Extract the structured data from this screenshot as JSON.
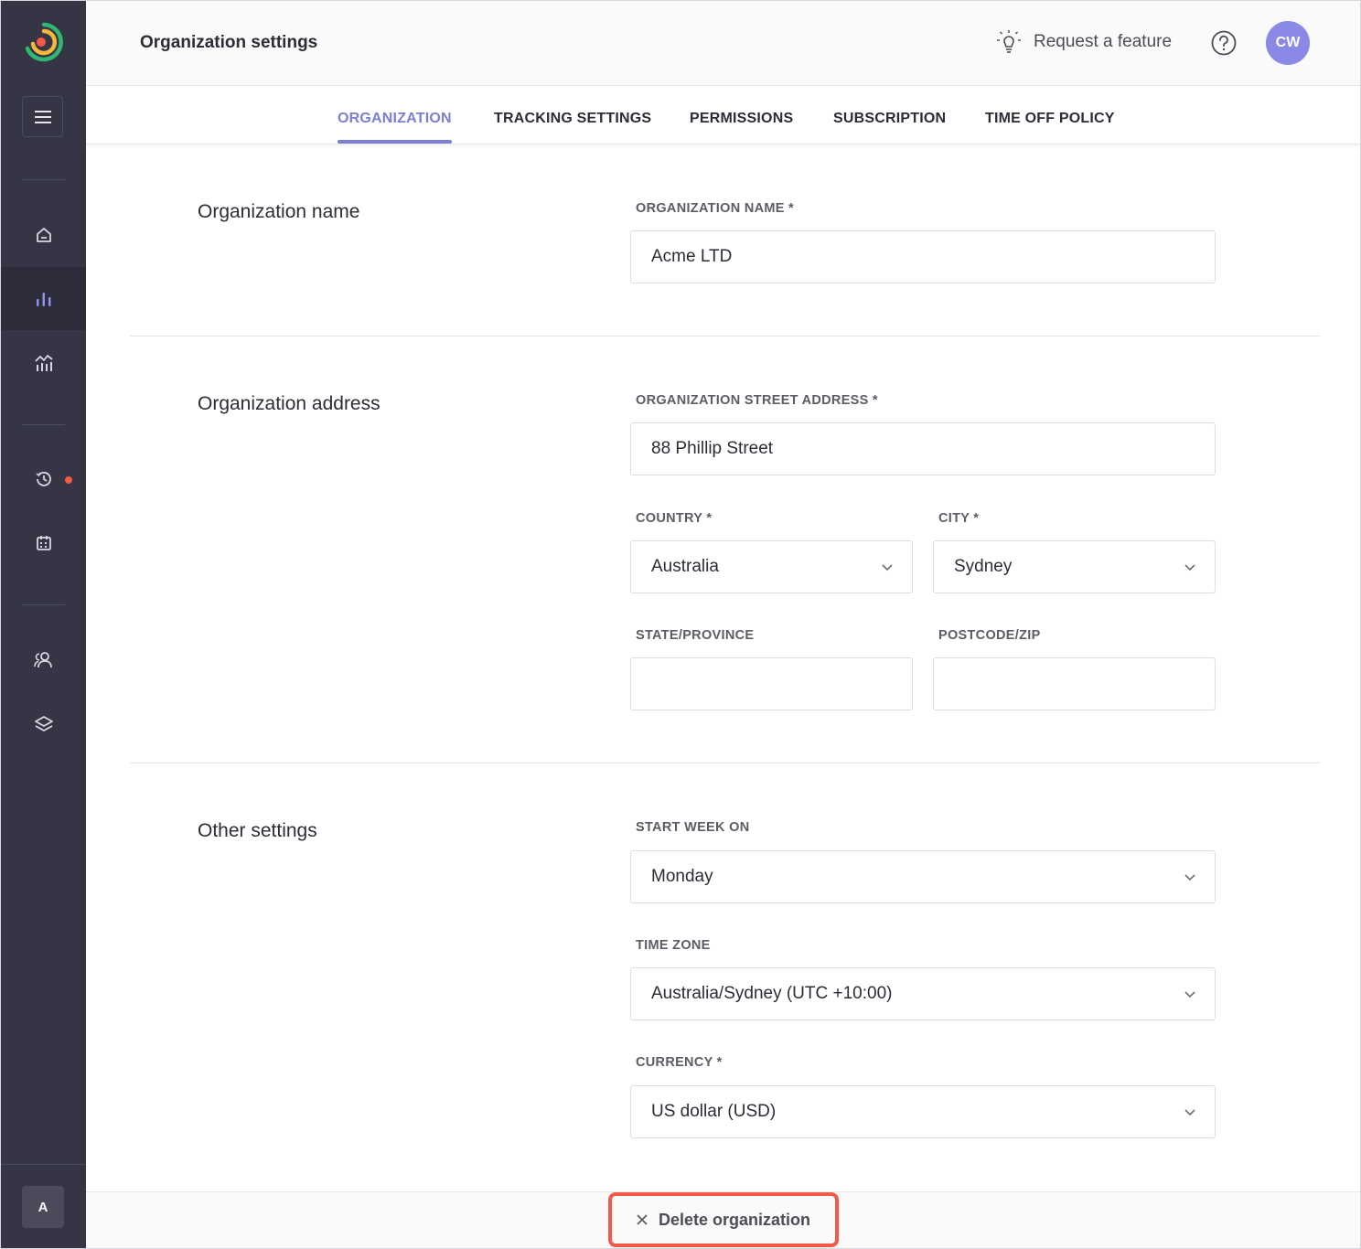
{
  "header": {
    "title": "Organization settings",
    "request_feature": "Request a feature",
    "avatar_initials": "CW"
  },
  "sidebar": {
    "workspace_letter": "A",
    "items": [
      "home",
      "dashboard",
      "reports",
      "timesheets",
      "calendar",
      "people",
      "projects"
    ],
    "active_item": "dashboard"
  },
  "tabs": [
    {
      "label": "ORGANIZATION",
      "active": true
    },
    {
      "label": "TRACKING SETTINGS",
      "active": false
    },
    {
      "label": "PERMISSIONS",
      "active": false
    },
    {
      "label": "SUBSCRIPTION",
      "active": false
    },
    {
      "label": "TIME OFF POLICY",
      "active": false
    }
  ],
  "sections": {
    "org_name": {
      "title": "Organization name",
      "label": "ORGANIZATION NAME *",
      "value": "Acme LTD"
    },
    "org_address": {
      "title": "Organization address",
      "street_label": "ORGANIZATION STREET ADDRESS *",
      "street_value": "88 Phillip Street",
      "country_label": "COUNTRY *",
      "country_value": "Australia",
      "city_label": "CITY *",
      "city_value": "Sydney",
      "state_label": "STATE/PROVINCE",
      "state_value": "",
      "postcode_label": "POSTCODE/ZIP",
      "postcode_value": ""
    },
    "other": {
      "title": "Other settings",
      "week_label": "START WEEK ON",
      "week_value": "Monday",
      "tz_label": "TIME ZONE",
      "tz_value": "Australia/Sydney (UTC +10:00)",
      "currency_label": "CURRENCY *",
      "currency_value": "US dollar (USD)"
    }
  },
  "footer": {
    "delete_label": "Delete organization"
  },
  "colors": {
    "accent": "#7b7fd1",
    "sidebar_bg": "#353546",
    "danger": "#f05a47",
    "avatar_bg": "#8a89e6"
  }
}
